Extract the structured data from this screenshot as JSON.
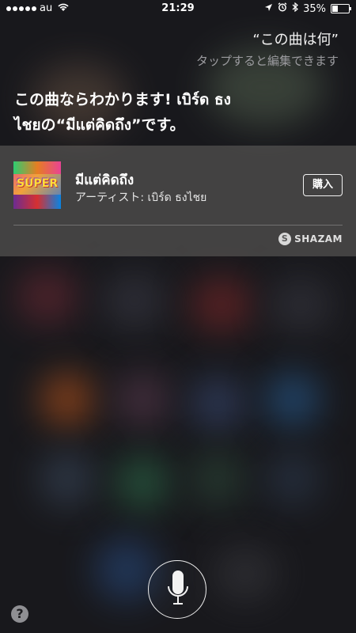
{
  "status_bar": {
    "carrier": "au",
    "time": "21:29",
    "battery": "35%",
    "battery_level": 0.35
  },
  "query": {
    "text": "“この曲は何”",
    "edit_hint": "タップすると編集できます"
  },
  "response": {
    "text": "この曲ならわかります! เบิร์ด ธงไชยの“มีแต่คิดถึง”です。"
  },
  "song_card": {
    "title": "มีแต่คิดถึง",
    "artist": "アーティスト: เบิร์ด ธงไชย",
    "buy_label": "購入",
    "album_art_text": "SUPER",
    "provider": "SHAZAM"
  },
  "controls": {
    "help_label": "?"
  },
  "icons": {
    "wifi": "wifi-icon",
    "location": "location-arrow-icon",
    "alarm": "alarm-icon",
    "bluetooth": "bluetooth-icon",
    "battery": "battery-icon",
    "microphone": "microphone-icon",
    "shazam": "shazam-logo-icon"
  }
}
